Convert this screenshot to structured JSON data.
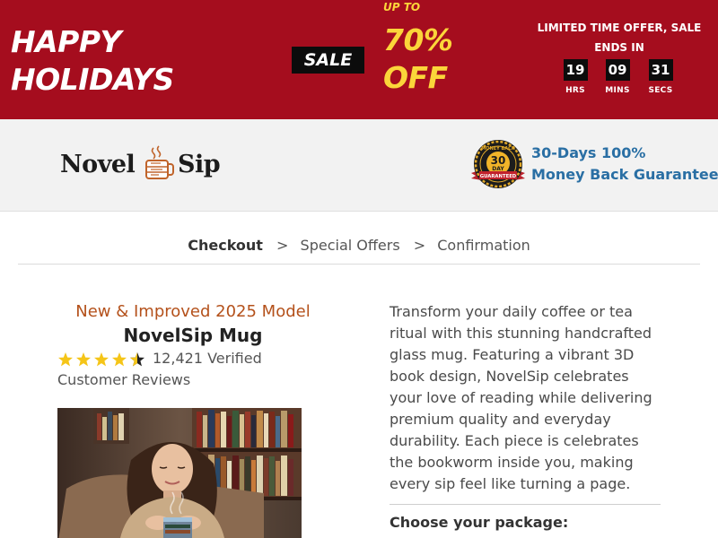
{
  "banner": {
    "title_line1": "HAPPY",
    "title_line2": "HOLIDAYS",
    "sale_badge": "SALE",
    "upto": "UP TO",
    "discount": "70%",
    "discount_suffix": "OFF",
    "offer_text": "LIMITED TIME OFFER, SALE ENDS IN",
    "countdown": {
      "hours": "19",
      "hours_label": "HRS",
      "mins": "09",
      "mins_label": "MINS",
      "secs": "31",
      "secs_label": "SECS"
    },
    "colors": {
      "background": "#a50d1e",
      "accent": "#fbd53a",
      "box": "#0c0c0c"
    }
  },
  "header": {
    "logo_word1": "Novel",
    "logo_word2": "Sip",
    "seal_icon": "money-back-guarantee-seal",
    "seal_text_top": "MONEY BACK",
    "seal_text_mid1": "30",
    "seal_text_mid2": "DAY",
    "seal_text_ribbon": "GUARANTEED",
    "guarantee_line1": "30-Days 100%",
    "guarantee_line2": "Money Back Guarantee"
  },
  "breadcrumb": {
    "step1": "Checkout",
    "step2": "Special Offers",
    "step3": "Confirmation",
    "separator": ">"
  },
  "product": {
    "model_line": "New & Improved 2025 Model",
    "name": "NovelSip Mug",
    "rating_value": 4.5,
    "rating_max": 5,
    "reviews_text": "12,421 Verified Customer Reviews",
    "description": "Transform your daily coffee or tea ritual with this stunning handcrafted glass mug. Featuring a vibrant 3D book design, NovelSip celebrates your love of reading while delivering premium quality and everyday durability. Each piece is celebrates the bookworm inside you, making every sip feel like turning a page.",
    "choose_label": "Choose your package:",
    "colors": {
      "model_line": "#b4511b",
      "guarantee": "#2a6fa4",
      "star": "#f5c518"
    }
  }
}
